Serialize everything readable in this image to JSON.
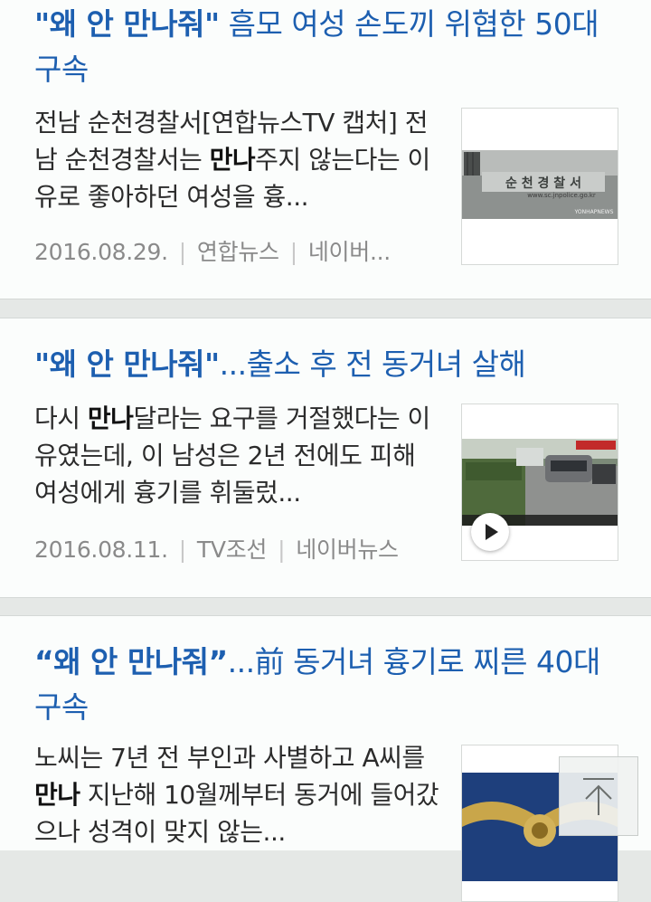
{
  "results": [
    {
      "title_quote": "\"왜 안 만나줘\"",
      "title_rest": " 흠모 여성 손도끼 위협한 50대 구속",
      "snippet_pre": "전남 순천경찰서[연합뉴스TV 캡처] 전남 순천경찰서는 ",
      "snippet_bold": "만나",
      "snippet_post": "주지 않는다는 이유로 좋아하던 여성을 흉...",
      "date": "2016.08.29.",
      "source": "연합뉴스",
      "portal": "네이버...",
      "thumb_sign": "순 천 경 찰 서",
      "thumb_url": "www.sc.jnpolice.go.kr",
      "thumb_watermark": "YONHAPNEWS"
    },
    {
      "title_quote": "\"왜 안 만나줘\"",
      "title_rest": "...출소 후 전 동거녀 살해",
      "snippet_pre": "다시 ",
      "snippet_bold": "만나",
      "snippet_post": "달라는 요구를 거절했다는 이유였는데, 이 남성은 2년 전에도 피해 여성에게 흉기를 휘둘렀...",
      "date": "2016.08.11.",
      "source": "TV조선",
      "portal": "네이버뉴스"
    },
    {
      "title_quote": "“왜 안 만나줘”",
      "title_rest": "...前 동거녀 흉기로 찌른 40대 구속",
      "snippet_pre": "노씨는 7년 전 부인과 사별하고 A씨를 ",
      "snippet_bold": "만나",
      "snippet_post": " 지난해 10월께부터 동거에 들어갔으나 성격이 맞지 않는..."
    }
  ],
  "icons": {
    "play": "play-icon",
    "scroll_top": "arrow-up-icon"
  },
  "colors": {
    "title": "#1d5fb0",
    "meta": "#8a8a8a",
    "background": "#e5e8e6",
    "card": "#fbfdfc"
  }
}
